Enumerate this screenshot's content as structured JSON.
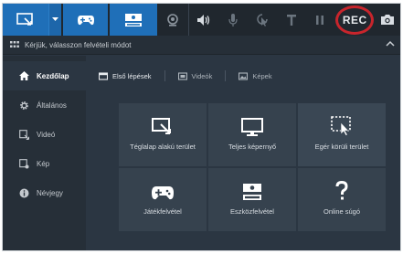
{
  "toolbar": {
    "rec_label": "REC",
    "accent": "#1f6fb8",
    "rec_ring": "#c8252c"
  },
  "header": {
    "title": "Kérjük, válasszon felvételi módot"
  },
  "sidebar": {
    "items": [
      {
        "label": "Kezdőlap",
        "icon": "home-icon",
        "active": true
      },
      {
        "label": "Általános",
        "icon": "gear-icon",
        "active": false
      },
      {
        "label": "Videó",
        "icon": "video-icon",
        "active": false
      },
      {
        "label": "Kép",
        "icon": "image-icon",
        "active": false
      },
      {
        "label": "Névjegy",
        "icon": "info-icon",
        "active": false
      }
    ]
  },
  "tabs": [
    {
      "label": "Első lépések",
      "icon": "first-steps-icon",
      "active": true
    },
    {
      "label": "Videók",
      "icon": "videos-icon",
      "active": false
    },
    {
      "label": "Képek",
      "icon": "images-icon",
      "active": false
    }
  ],
  "modes": [
    {
      "label": "Téglalap alakú terület",
      "icon": "rectangle-area-icon"
    },
    {
      "label": "Teljes képernyő",
      "icon": "monitor-icon"
    },
    {
      "label": "Egér körüli terület",
      "icon": "mouse-area-icon"
    },
    {
      "label": "Játékfelvétel",
      "icon": "gamepad-icon"
    },
    {
      "label": "Eszközfelvétel",
      "icon": "hdmi-device-icon"
    },
    {
      "label": "Online súgó",
      "icon": "question-icon"
    }
  ]
}
